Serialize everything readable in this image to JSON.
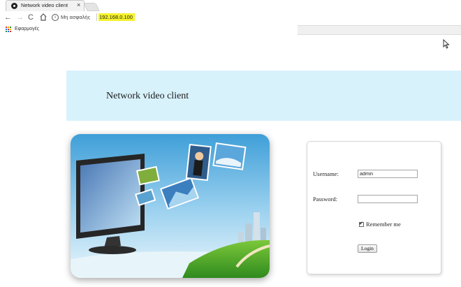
{
  "browser": {
    "tab_title": "Network video client",
    "tab_close": "×",
    "not_secure_label": "Μη ασφαλής",
    "url": "192.168.0.100",
    "bookmarks_apps_label": "Εφαρμογές",
    "url_highlight_color": "#f5f22a",
    "icons": [
      "back-arrow-icon",
      "forward-arrow-icon",
      "reload-icon",
      "home-icon",
      "info-icon",
      "apps-grid-icon",
      "mouse-cursor-icon"
    ]
  },
  "page": {
    "banner_title": "Network video client",
    "banner_color": "#d8f2fc",
    "login": {
      "username_label": "Username:",
      "username_value": "admin",
      "password_label": "Password:",
      "password_value": "",
      "remember_label": "Remember me",
      "remember_checked": true,
      "login_button": "Login"
    }
  }
}
